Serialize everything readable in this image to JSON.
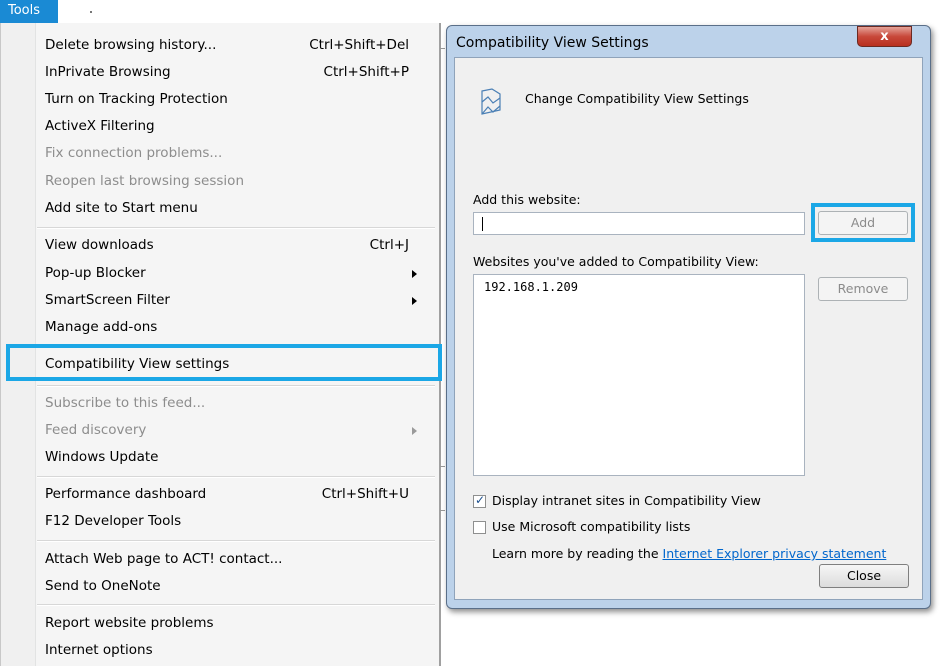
{
  "menubar": {
    "tools_label": "Tools"
  },
  "menu": {
    "items": [
      {
        "label": "Delete browsing history...",
        "shortcut": "Ctrl+Shift+Del"
      },
      {
        "label": "InPrivate Browsing",
        "shortcut": "Ctrl+Shift+P"
      },
      {
        "label": "Turn on Tracking Protection",
        "shortcut": ""
      },
      {
        "label": "ActiveX Filtering",
        "shortcut": ""
      },
      {
        "label": "Fix connection problems...",
        "shortcut": ""
      },
      {
        "label": "Reopen last browsing session",
        "shortcut": ""
      },
      {
        "label": "Add site to Start menu",
        "shortcut": ""
      },
      {
        "label": "View downloads",
        "shortcut": "Ctrl+J"
      },
      {
        "label": "Pop-up Blocker",
        "shortcut": ""
      },
      {
        "label": "SmartScreen Filter",
        "shortcut": ""
      },
      {
        "label": "Manage add-ons",
        "shortcut": ""
      },
      {
        "label": "Compatibility View settings",
        "shortcut": ""
      },
      {
        "label": "Subscribe to this feed...",
        "shortcut": ""
      },
      {
        "label": "Feed discovery",
        "shortcut": ""
      },
      {
        "label": "Windows Update",
        "shortcut": ""
      },
      {
        "label": "Performance dashboard",
        "shortcut": "Ctrl+Shift+U"
      },
      {
        "label": "F12 Developer Tools",
        "shortcut": ""
      },
      {
        "label": "Attach Web page to ACT! contact...",
        "shortcut": ""
      },
      {
        "label": "Send to OneNote",
        "shortcut": ""
      },
      {
        "label": "Report website problems",
        "shortcut": ""
      },
      {
        "label": "Internet options",
        "shortcut": ""
      }
    ]
  },
  "dialog": {
    "title": "Compatibility View Settings",
    "close_glyph": "x",
    "header": "Change Compatibility View Settings",
    "add_label": "Add this website:",
    "add_value": "",
    "add_button": "Add",
    "list_label": "Websites you've added to Compatibility View:",
    "sites": [
      "192.168.1.209"
    ],
    "remove_button": "Remove",
    "checkbox1": {
      "label": "Display intranet sites in Compatibility View",
      "checked": true
    },
    "checkbox2": {
      "label": "Use Microsoft compatibility lists",
      "checked": false
    },
    "learn_text": "Learn more by reading the ",
    "learn_link": "Internet Explorer privacy statement",
    "close_button": "Close"
  },
  "colors": {
    "highlight": "#1ba7e6",
    "tools_tab": "#1a8ad4",
    "link": "#0066cc"
  }
}
